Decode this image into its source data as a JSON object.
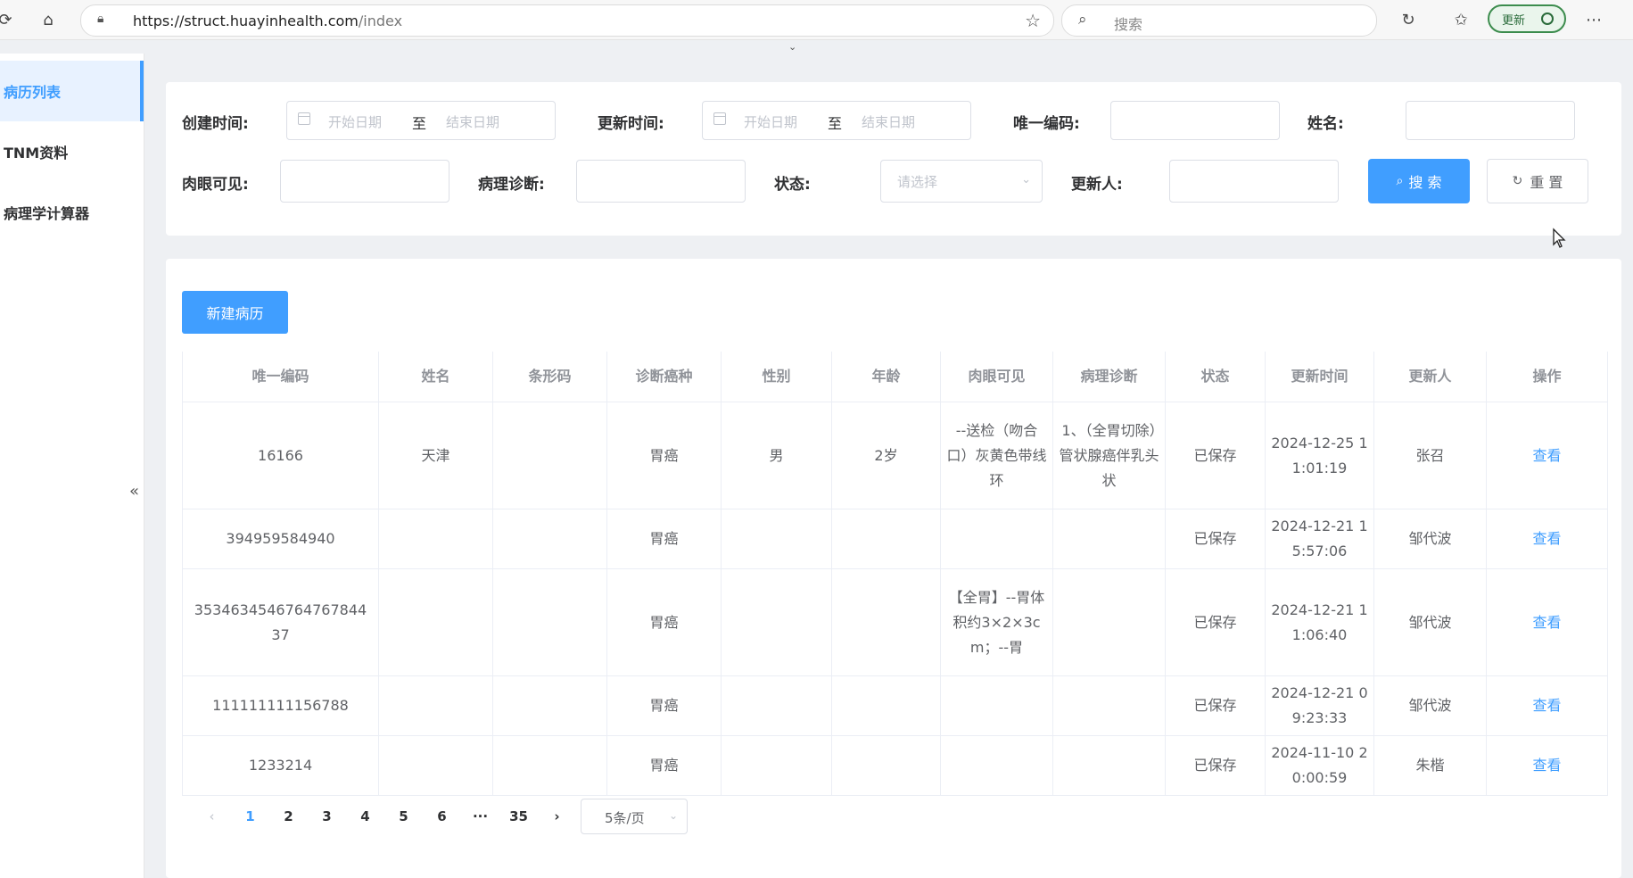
{
  "browser": {
    "url_host": "https://struct.huayinhealth.com",
    "url_path": "/index",
    "search_placeholder": "搜索",
    "update_label": "更新"
  },
  "sidebar": {
    "items": [
      {
        "label": "病历列表",
        "active": true
      },
      {
        "label": "TNM资料",
        "active": false
      },
      {
        "label": "病理学计算器",
        "active": false
      }
    ],
    "collapse_glyph": "«"
  },
  "filters": {
    "created_label": "创建时间:",
    "updated_label": "更新时间:",
    "date_start_placeholder": "开始日期",
    "date_sep": "至",
    "date_end_placeholder": "结束日期",
    "uid_label": "唯一编码:",
    "name_label": "姓名:",
    "gross_label": "肉眼可见:",
    "patho_label": "病理诊断:",
    "status_label": "状态:",
    "status_placeholder": "请选择",
    "updater_label": "更新人:",
    "search_button": "搜 索",
    "reset_button": "重 置"
  },
  "toolbar": {
    "new_record_button": "新建病历"
  },
  "table": {
    "columns": [
      "唯一编码",
      "姓名",
      "条形码",
      "诊断癌种",
      "性别",
      "年龄",
      "肉眼可见",
      "病理诊断",
      "状态",
      "更新时间",
      "更新人",
      "操作"
    ],
    "rows": [
      {
        "uid": "16166",
        "name": "天津",
        "barcode": "",
        "cancer": "胃癌",
        "sex": "男",
        "age": "2岁",
        "gross": "--送检（吻合口）灰黄色带线环",
        "patho": "1、（全胃切除）管状腺癌伴乳头状",
        "status": "已保存",
        "updated": "2024-12-25 11:01:19",
        "updater": "张召",
        "action": "查看"
      },
      {
        "uid": "394959584940",
        "name": "",
        "barcode": "",
        "cancer": "胃癌",
        "sex": "",
        "age": "",
        "gross": "",
        "patho": "",
        "status": "已保存",
        "updated": "2024-12-21 15:57:06",
        "updater": "邹代波",
        "action": "查看"
      },
      {
        "uid": "3534634546764767844 37",
        "name": "",
        "barcode": "",
        "cancer": "胃癌",
        "sex": "",
        "age": "",
        "gross": "【全胃】--胃体积约3×2×3cm；--胃",
        "patho": "",
        "status": "已保存",
        "updated": "2024-12-21 11:06:40",
        "updater": "邹代波",
        "action": "查看"
      },
      {
        "uid": "111111111156788",
        "name": "",
        "barcode": "",
        "cancer": "胃癌",
        "sex": "",
        "age": "",
        "gross": "",
        "patho": "",
        "status": "已保存",
        "updated": "2024-12-21 09:23:33",
        "updater": "邹代波",
        "action": "查看"
      },
      {
        "uid": "1233214",
        "name": "",
        "barcode": "",
        "cancer": "胃癌",
        "sex": "",
        "age": "",
        "gross": "",
        "patho": "",
        "status": "已保存",
        "updated": "2024-11-10 20:00:59",
        "updater": "朱楷",
        "action": "查看"
      }
    ]
  },
  "pagination": {
    "prev": "‹",
    "pages": [
      "1",
      "2",
      "3",
      "4",
      "5",
      "6",
      "···",
      "35"
    ],
    "current": "1",
    "next": "›",
    "page_size": "5条/页"
  },
  "colors": {
    "primary": "#409eff",
    "update_green": "#3c8c4d"
  }
}
